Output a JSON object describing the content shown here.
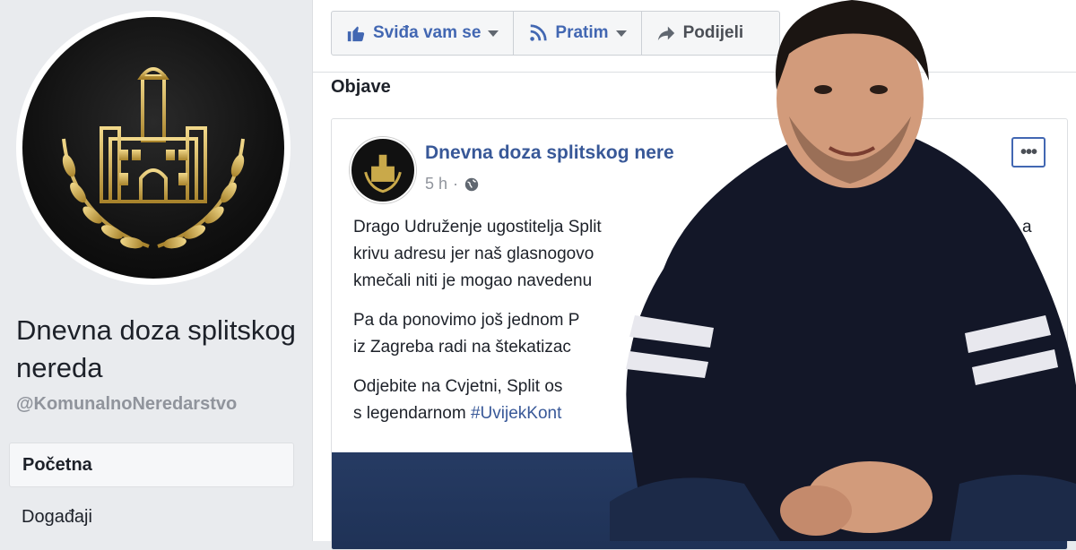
{
  "sidebar": {
    "page_name": "Dnevna doza splitskog nereda",
    "handle": "@KomunalnoNeredarstvo",
    "nav": [
      {
        "label": "Početna"
      },
      {
        "label": "Događaji"
      }
    ]
  },
  "actions": {
    "like_label": "Sviđa vam se",
    "follow_label": "Pratim",
    "share_label": "Podijeli"
  },
  "section_title": "Objave",
  "post": {
    "author": "Dnevna doza splitskog nere",
    "time": "5 h",
    "paragraphs": [
      "Drago Udruženje ugostitelja Split",
      "krivu adresu jer naš glasnogovo",
      "kmečali niti je mogao navedenu",
      "Pa da ponovimo još jednom P",
      "iz Zagreba radi na štekatizac",
      "Odjebite na Cvjetni, Split os",
      "s legendarnom "
    ],
    "hashtag": "#UvijekKont",
    "stray_letter": "a"
  },
  "colors": {
    "fb_blue": "#385898",
    "gold": "#c9a94a"
  }
}
